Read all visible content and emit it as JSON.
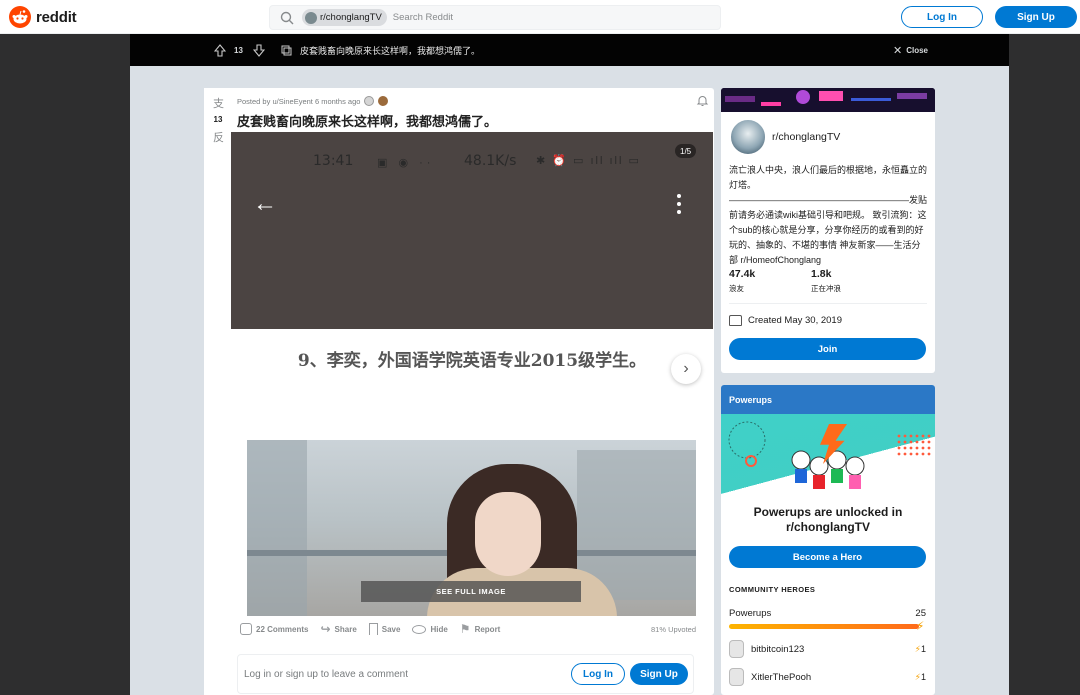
{
  "header": {
    "logo_text": "reddit",
    "search_chip": "r/chonglangTV",
    "search_placeholder": "Search Reddit",
    "login": "Log In",
    "signup": "Sign Up"
  },
  "postbar": {
    "vote_count": "13",
    "title": "皮套贱畜向晚原来长这样啊，我都想鸿儒了。",
    "close": "Close"
  },
  "post": {
    "vote_top": "支",
    "vote_count": "13",
    "vote_bottom": "反",
    "meta": "Posted by u/SineEyent 6 months ago",
    "title": "皮套贱畜向晚原来长这样啊，我都想鸿儒了。",
    "gallery": {
      "counter": "1/5",
      "time": "13:41",
      "speed": "48.1K/s",
      "caption": "9、李奕，外国语学院英语专业2015级学生。",
      "see_full": "SEE FULL IMAGE"
    },
    "actions": {
      "comments": "22 Comments",
      "share": "Share",
      "save": "Save",
      "hide": "Hide",
      "report": "Report",
      "upvoted": "81% Upvoted"
    },
    "comment_prompt": "Log in or sign up to leave a comment",
    "comment_login": "Log In",
    "comment_signup": "Sign Up"
  },
  "community": {
    "name": "r/chonglangTV",
    "description": "流亡浪人中央，浪人们最后的根据地，永恒矗立的灯塔。————————————————————发贴前请务必通读wiki基础引导和吧规。 致引流狗：这个sub的核心就是分享，分享你经历的或看到的好玩的、抽象的、不堪的事情 神友新家——生活分部 r/HomeofChonglang",
    "members": "47.4k",
    "members_label": "浪友",
    "online": "1.8k",
    "online_label": "正在冲浪",
    "created": "Created May 30, 2019",
    "join": "Join"
  },
  "powerups": {
    "header": "Powerups",
    "title": "Powerups are unlocked in r/chonglangTV",
    "button": "Become a Hero",
    "heroes_label": "COMMUNITY HEROES",
    "count_label": "Powerups",
    "count": "25",
    "progress": 1.0,
    "heroes": [
      {
        "name": "bitbitcoin123",
        "count": "1"
      },
      {
        "name": "XitlerThePooh",
        "count": "1"
      }
    ]
  },
  "colors": {
    "brand": "#ff4500",
    "accent": "#0079d3",
    "powerup_header": "#2b78c6"
  }
}
